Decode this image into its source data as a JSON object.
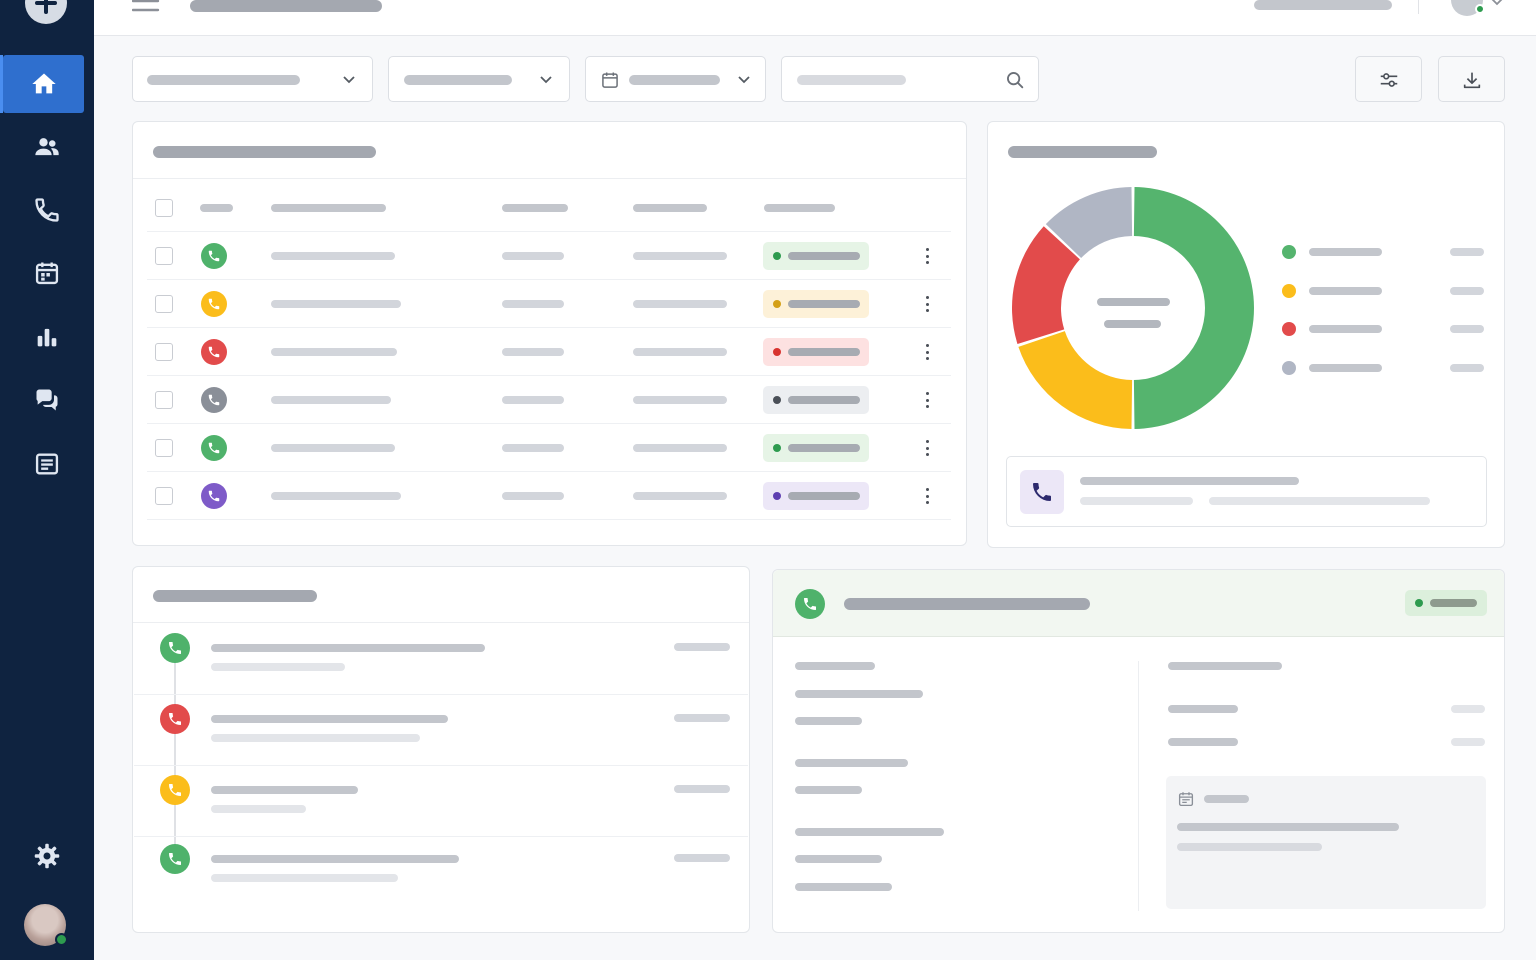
{
  "colors": {
    "sidebar_bg": "#0f2340",
    "accent": "#2f6fce",
    "answered": "#4fb26b",
    "pending": "#fbbd1b",
    "missed": "#e24b4b",
    "neutral": "#8a8f98",
    "voicemail": "#7e5bc8",
    "legend_unknown": "#b0b6c4"
  },
  "sidebar": {
    "logo_icon": "plus-shield-icon",
    "items": [
      {
        "icon": "home-icon",
        "active": true
      },
      {
        "icon": "users-icon",
        "active": false
      },
      {
        "icon": "phone-icon",
        "active": false
      },
      {
        "icon": "calendar-icon",
        "active": false
      },
      {
        "icon": "bar-chart-icon",
        "active": false
      },
      {
        "icon": "chat-icon",
        "active": false
      },
      {
        "icon": "notes-icon",
        "active": false
      }
    ],
    "settings_icon": "gear-icon",
    "user_status": "online"
  },
  "topbar": {
    "menu_icon": "hamburger-icon",
    "user_status": "online"
  },
  "filters": {
    "select_icon": "chevron-down-icon",
    "date_icon": "calendar-icon",
    "search_icon": "search-icon",
    "filter_button_icon": "sliders-icon",
    "download_button_icon": "download-icon"
  },
  "calls_table": {
    "rows": [
      {
        "type": "answered",
        "status": "answered"
      },
      {
        "type": "pending",
        "status": "pending"
      },
      {
        "type": "missed",
        "status": "missed"
      },
      {
        "type": "neutral",
        "status": "neutral"
      },
      {
        "type": "answered",
        "status": "answered"
      },
      {
        "type": "voicemail",
        "status": "voicemail"
      }
    ]
  },
  "chart_data": {
    "type": "pie",
    "donut": true,
    "values": [
      50,
      20,
      17,
      13
    ],
    "colors": [
      "#55b46e",
      "#fbbd1b",
      "#e24b4b",
      "#b0b6c4"
    ]
  },
  "call_history": {
    "items": [
      {
        "type": "answered"
      },
      {
        "type": "missed"
      },
      {
        "type": "pending"
      },
      {
        "type": "answered"
      }
    ]
  },
  "call_detail": {
    "header_status": "answered"
  }
}
